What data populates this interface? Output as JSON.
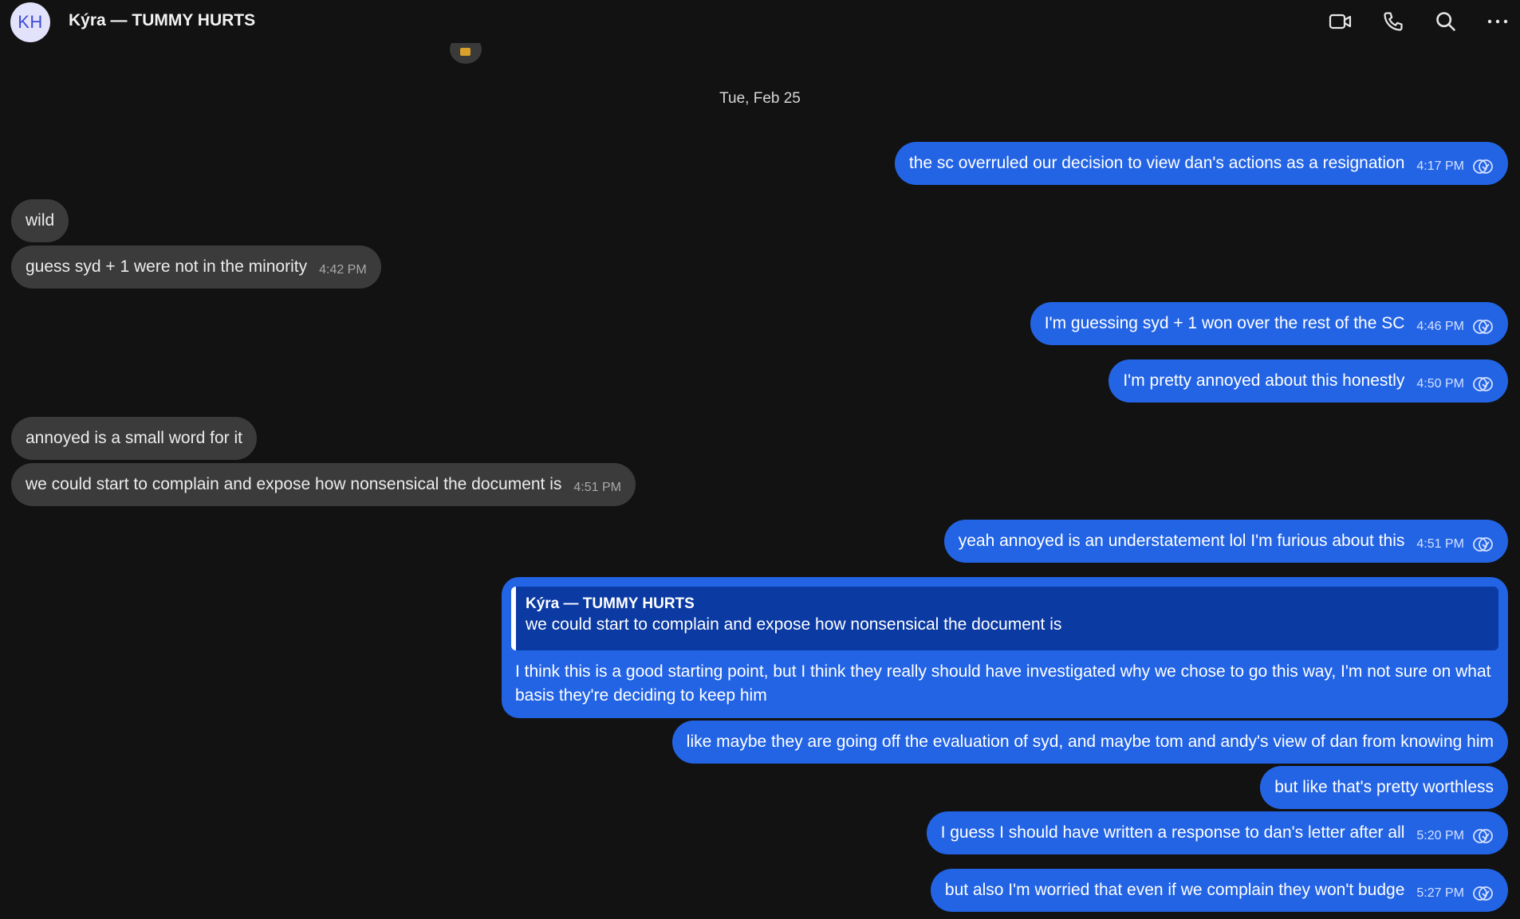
{
  "header": {
    "avatar_initials": "KH",
    "contact_name": "Kýra — TUMMY HURTS",
    "actions": [
      "video-call-icon",
      "voice-call-icon",
      "search-icon",
      "more-options-icon"
    ]
  },
  "date_separator": "Tue, Feb 25",
  "messages": [
    {
      "dir": "out",
      "text": "the sc overruled our decision to view dan's actions as a resignation",
      "time": "4:17 PM",
      "status": "read"
    },
    {
      "dir": "in",
      "text": "wild",
      "time": ""
    },
    {
      "dir": "in",
      "text": "guess syd + 1 were not in the minority",
      "time": "4:42 PM"
    },
    {
      "dir": "out",
      "text": "I'm guessing syd + 1 won over the rest of the SC",
      "time": "4:46 PM",
      "status": "read"
    },
    {
      "dir": "out",
      "text": "I'm pretty annoyed about this honestly",
      "time": "4:50 PM",
      "status": "read"
    },
    {
      "dir": "in",
      "text": "annoyed is a small word for it",
      "time": ""
    },
    {
      "dir": "in",
      "text": "we could start to complain and expose how nonsensical the document is",
      "time": "4:51 PM"
    },
    {
      "dir": "out",
      "text": "yeah annoyed is an understatement lol I'm furious about this",
      "time": "4:51 PM",
      "status": "read"
    },
    {
      "dir": "out",
      "quote": {
        "author": "Kýra — TUMMY HURTS",
        "text": "we could start to complain and expose how nonsensical the document is"
      },
      "text": "I think this is a good starting point, but I think they really should have investigated why we chose to go this way, I'm not sure on what basis they're deciding to keep him",
      "time": ""
    },
    {
      "dir": "out",
      "text": "like maybe they are going off the evaluation of syd, and maybe tom and andy's view of dan from knowing him",
      "time": ""
    },
    {
      "dir": "out",
      "text": "but like that's pretty worthless",
      "time": ""
    },
    {
      "dir": "out",
      "text": "I guess I should have written a response to dan's letter after all",
      "time": "5:20 PM",
      "status": "read"
    },
    {
      "dir": "out",
      "text": "but also I'm worried that even if we complain they won't budge",
      "time": "5:27 PM",
      "status": "read"
    }
  ],
  "colors": {
    "background": "#121212",
    "outgoing": "#2364e5",
    "incoming": "#3b3b3b",
    "quote_box": "#0b3aa3"
  }
}
